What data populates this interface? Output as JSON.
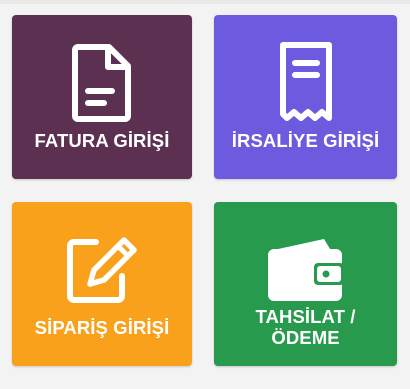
{
  "tiles": [
    {
      "label": "FATURA GİRİŞİ",
      "icon": "invoice-document-icon",
      "color": "#5b3050"
    },
    {
      "label": "İRSALİYE GİRİŞİ",
      "icon": "receipt-icon",
      "color": "#6c5bde"
    },
    {
      "label": "SİPARİŞ GİRİŞİ",
      "icon": "edit-pencil-icon",
      "color": "#f9a11b"
    },
    {
      "label": "TAHSİLAT / ÖDEME",
      "icon": "wallet-icon",
      "color": "#279a4d"
    }
  ]
}
